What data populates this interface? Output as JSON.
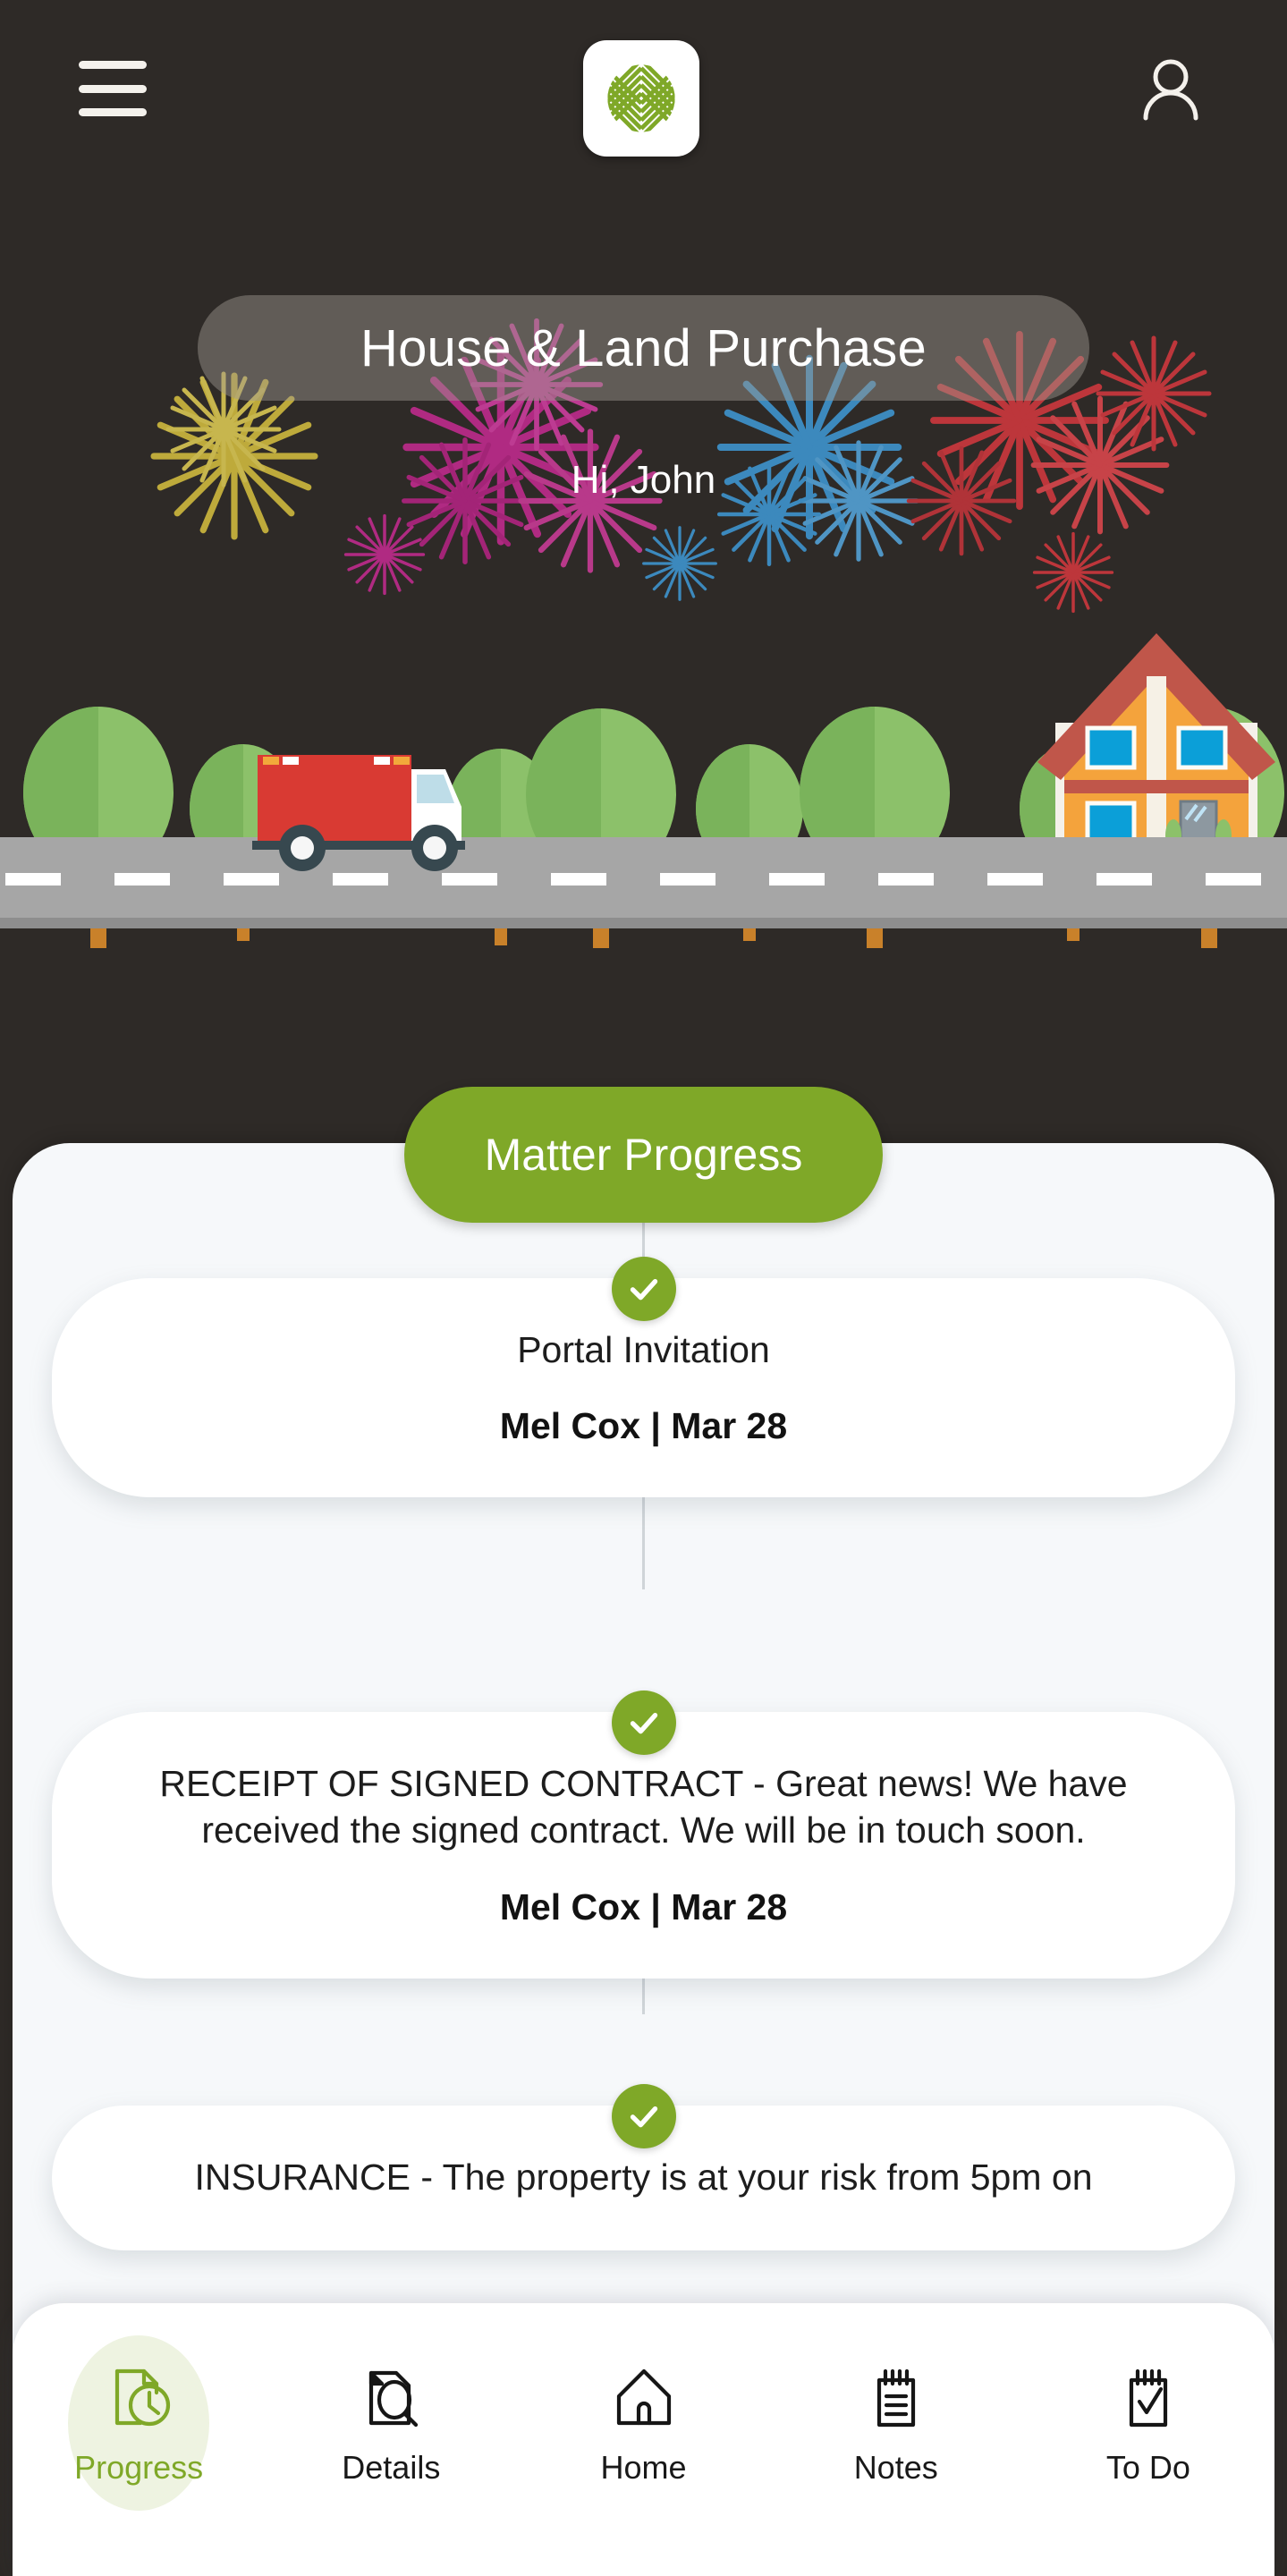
{
  "theme": {
    "background": "#2e2a27",
    "panel": "#f6f8fa",
    "accent_green": "#7fa828",
    "card": "#ffffff",
    "text_dark": "#1d1d1d",
    "nav_active_blob": "#eef3e1"
  },
  "header": {
    "menu_label": "Menu",
    "logo_label": "App logo",
    "profile_label": "Profile"
  },
  "hero": {
    "matter_title": "House & Land Purchase",
    "greeting": "Hi, John",
    "scene_label": "Moving truck driving to new house illustration"
  },
  "progress": {
    "section_title": "Matter Progress",
    "steps": [
      {
        "status": "complete",
        "body": "Portal Invitation",
        "author": "Mel Cox",
        "date": "Mar 28",
        "meta": "Mel Cox |  Mar 28"
      },
      {
        "status": "complete",
        "body": "RECEIPT OF SIGNED CONTRACT - Great news! We have received the signed contract. We will be in touch soon.",
        "author": "Mel Cox",
        "date": "Mar 28",
        "meta": "Mel Cox |  Mar 28"
      },
      {
        "status": "complete",
        "body": "INSURANCE - The property is at your risk from 5pm on",
        "author": "",
        "date": "",
        "meta": ""
      }
    ]
  },
  "bottom_nav": {
    "items": [
      {
        "label": "Progress",
        "icon": "document-clock-icon",
        "active": true
      },
      {
        "label": "Details",
        "icon": "document-search-icon",
        "active": false
      },
      {
        "label": "Home",
        "icon": "home-icon",
        "active": false
      },
      {
        "label": "Notes",
        "icon": "notepad-lines-icon",
        "active": false
      },
      {
        "label": "To Do",
        "icon": "notepad-check-icon",
        "active": false
      }
    ]
  }
}
